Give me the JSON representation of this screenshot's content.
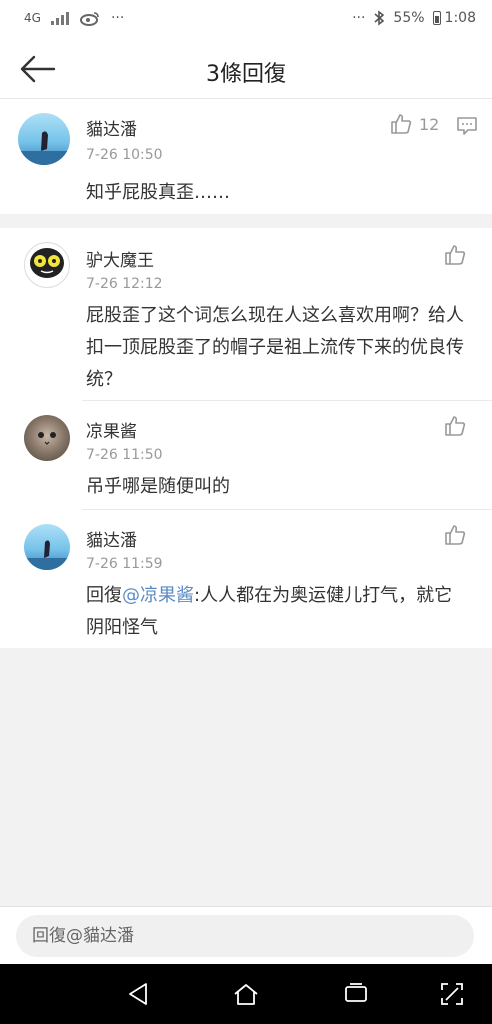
{
  "status_bar": {
    "network": "4G",
    "more_left": "···",
    "more_right": "···",
    "battery": "55%",
    "time": "1:08"
  },
  "header": {
    "title": "3條回復"
  },
  "main_comment": {
    "user": "貓达潘",
    "time": "7-26 10:50",
    "text": "知乎屁股真歪……",
    "like_count": "12"
  },
  "replies": [
    {
      "user": "驴大魔王",
      "time": "7-26 12:12",
      "text": "屁股歪了这个词怎么现在人这么喜欢用啊？给人扣一顶屁股歪了的帽子是祖上流传下来的优良传统？"
    },
    {
      "user": "凉果酱",
      "time": "7-26 11:50",
      "text": "吊乎哪是随便叫的"
    },
    {
      "user": "貓达潘",
      "time": "7-26 11:59",
      "reply_prefix": "回復",
      "mention": "@凉果酱",
      "text": ":人人都在为奥运健儿打气，就它阴阳怪气"
    }
  ],
  "input": {
    "placeholder": "回復@貓达潘"
  },
  "colors": {
    "mention": "#5b8bc5",
    "background": "#f2f2f2"
  }
}
